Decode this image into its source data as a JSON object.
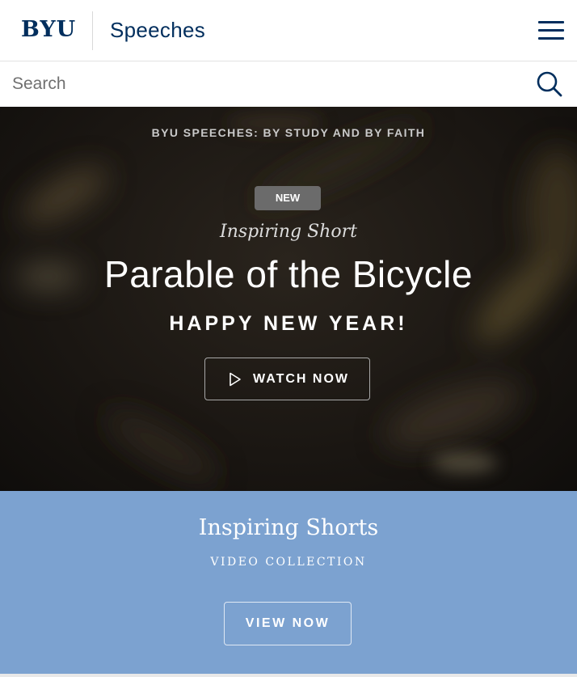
{
  "header": {
    "logo_text": "BYU",
    "site_title": "Speeches",
    "menu_icon": "hamburger-menu-icon",
    "brand_color": "#002e5d"
  },
  "search": {
    "placeholder": "Search",
    "value": "",
    "icon": "search-icon"
  },
  "hero": {
    "kicker": "BYU SPEECHES: BY STUDY AND BY FAITH",
    "badge": "NEW",
    "category": "Inspiring Short",
    "title": "Parable of the Bicycle",
    "subtitle": "HAPPY NEW YEAR!",
    "cta_label": "WATCH NOW",
    "cta_icon": "play-icon"
  },
  "collection": {
    "title": "Inspiring Shorts",
    "subtitle": "VIDEO COLLECTION",
    "cta_label": "VIEW NOW",
    "background_color": "#7ca2d0"
  }
}
